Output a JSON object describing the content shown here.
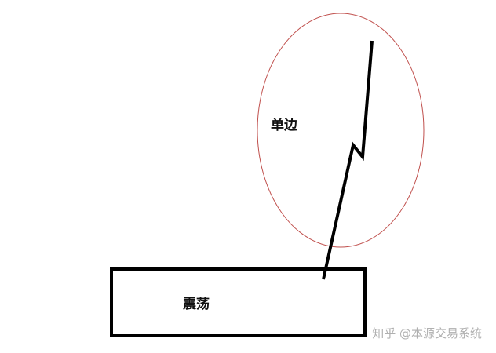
{
  "labels": {
    "trend": "单边",
    "range": "震荡"
  },
  "watermark": "知乎 @本源交易系统",
  "colors": {
    "background": "#ffffff",
    "ellipse_stroke": "#c0504d",
    "rect_stroke": "#000000",
    "line_stroke": "#000000",
    "watermark": "#b0b0b0"
  }
}
